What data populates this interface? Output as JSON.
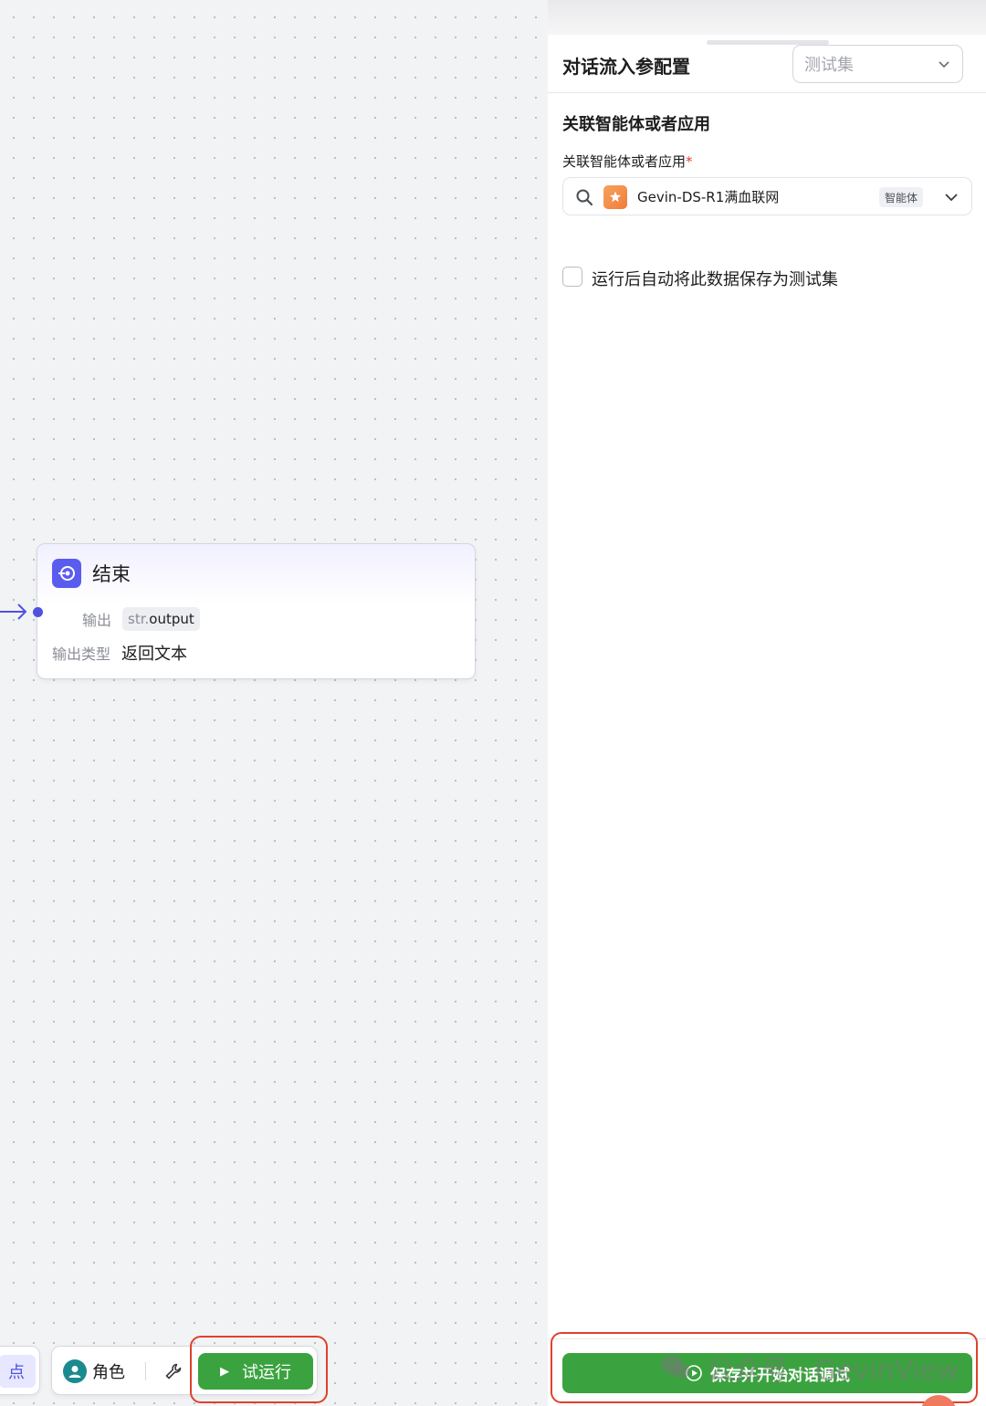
{
  "canvas": {
    "end_node": {
      "title": "结束",
      "output_label": "输出",
      "output_type": "str.",
      "output_var": "output",
      "type_label": "输出类型",
      "type_value": "返回文本"
    },
    "toolbar": {
      "left_partial_label": "点",
      "role_label": "角色",
      "run_label": "试运行"
    }
  },
  "panel": {
    "title": "对话流入参配置",
    "testset_placeholder": "测试集",
    "section_title": "关联智能体或者应用",
    "field_label": "关联智能体或者应用",
    "required_mark": "*",
    "selected_agent": "Gevin-DS-R1满血联网",
    "agent_tag": "智能体",
    "checkbox_label": "运行后自动将此数据保存为测试集",
    "checkbox_checked": false,
    "start_button": "保存并开始对话调试"
  },
  "watermark": {
    "text": "公众号 · GevinView",
    "icon": "wechat-icon"
  },
  "colors": {
    "accent_green": "#3aa33f",
    "node_purple": "#5a5cf0",
    "highlight_red": "#e0402d"
  }
}
